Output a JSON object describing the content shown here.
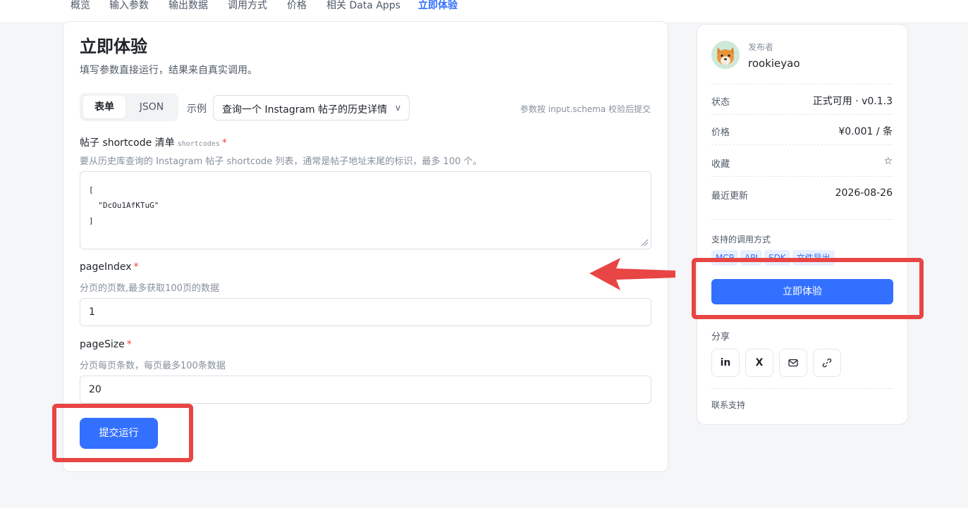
{
  "nav": {
    "tabs": [
      "概览",
      "输入参数",
      "输出数据",
      "调用方式",
      "价格",
      "相关 Data Apps",
      "立即体验"
    ],
    "active_tab": "立即体验"
  },
  "main": {
    "title": "立即体验",
    "description": "填写参数直接运行，结果来自真实调用。",
    "mode_form": "表单",
    "mode_json": "JSON",
    "example_label": "示例",
    "example_selected": "查询一个 Instagram 帖子的历史详情",
    "schema_note": "参数按 input.schema 校验后提交",
    "shortcodes": {
      "label": "帖子 shortcode 清单",
      "key": "shortcodes",
      "required_mark": "*",
      "description": "要从历史库查询的 Instagram 帖子 shortcode 列表，通常是帖子地址末尾的标识，最多 100 个。",
      "value": "[\n  \"DcOu1AfKTuG\"\n]"
    },
    "page_index": {
      "label": "pageIndex",
      "required_mark": "*",
      "description": "分页的页数,最多获取100页的数据",
      "value": "1"
    },
    "page_size": {
      "label": "pageSize",
      "required_mark": "*",
      "description": "分页每页条数，每页最多100条数据",
      "value": "20"
    },
    "submit_label": "提交运行"
  },
  "sidebar": {
    "publisher_label": "发布者",
    "publisher_name": "rookieyao",
    "status_label": "状态",
    "status_value": "正式可用 · v0.1.3",
    "price_label": "价格",
    "price_value": "¥0.001 / 条",
    "favorite_label": "收藏",
    "favorite_icon": "☆",
    "updated_label": "最近更新",
    "updated_value": "2026-08-26",
    "methods_label": "支持的调用方式",
    "methods": [
      "MCP",
      "API",
      "SDK",
      "文件导出"
    ],
    "try_label": "立即体验",
    "share_label": "分享",
    "share_buttons": [
      "in",
      "X"
    ],
    "contact_label": "联系支持"
  },
  "colors": {
    "accent": "#3370ff",
    "annotation": "#e84545",
    "required": "#f53f3f"
  }
}
